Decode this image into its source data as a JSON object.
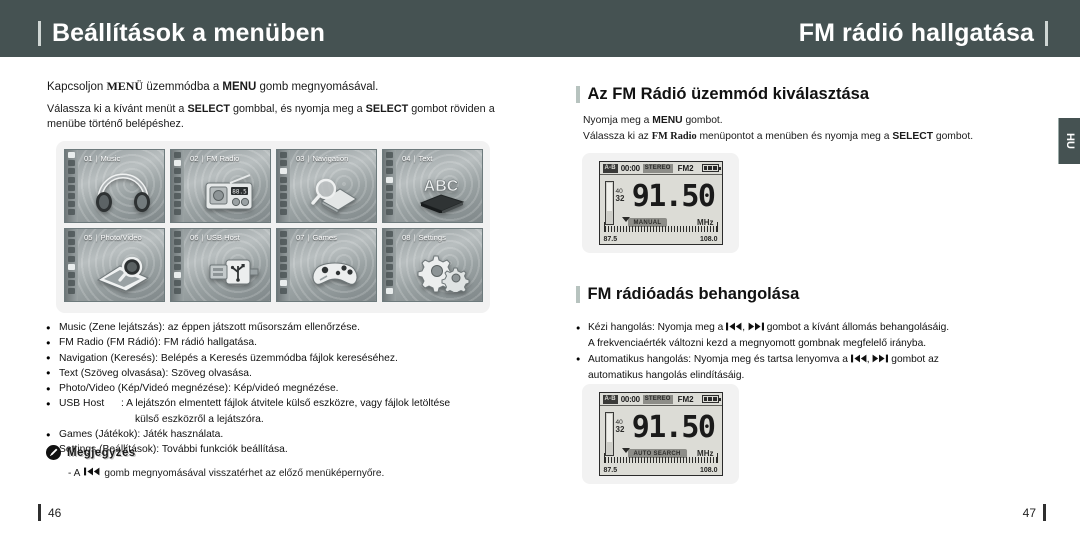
{
  "header": {
    "left_title": "Beállítások a menüben",
    "right_title": "FM rádió hallgatása",
    "side_tab": "HU"
  },
  "left": {
    "intro_line1_a": "Kapcsoljon ",
    "intro_line1_smallcaps": "MENÜ",
    "intro_line1_b": " üzemmódba a ",
    "intro_line1_bold": "MENU",
    "intro_line1_c": " gomb megnyomásával.",
    "intro_line2_a": "Válassza ki a kívánt menüt a ",
    "intro_line2_bold1": "SELECT",
    "intro_line2_b": " gombbal, és nyomja meg a ",
    "intro_line2_bold2": "SELECT",
    "intro_line2_c": " gombot röviden a menübe történő belépéshez.",
    "tiles": [
      {
        "num": "01",
        "label": "Music",
        "icon": "headphones-icon"
      },
      {
        "num": "02",
        "label": "FM Radio",
        "icon": "radio-icon"
      },
      {
        "num": "03",
        "label": "Navigation",
        "icon": "magnifier-book-icon"
      },
      {
        "num": "04",
        "label": "Text",
        "icon": "abc-book-icon"
      },
      {
        "num": "05",
        "label": "Photo/Video",
        "icon": "photo-magnifier-icon"
      },
      {
        "num": "06",
        "label": "USB Host",
        "icon": "usb-plug-icon"
      },
      {
        "num": "07",
        "label": "Games",
        "icon": "gamepad-icon"
      },
      {
        "num": "08",
        "label": "Settings",
        "icon": "gears-icon"
      }
    ],
    "bullets": [
      "Music (Zene lejátszás): az éppen játszott műsorszám ellenőrzése.",
      "FM Radio (FM Rádió): FM rádió hallgatása.",
      "Navigation (Keresés): Belépés a Keresés üzemmódba fájlok kereséséhez.",
      "Text (Szöveg olvasása): Szöveg olvasása.",
      "Photo/Video (Kép/Videó megnézése): Kép/videó megnézése."
    ],
    "usb_bullet": {
      "key": "USB Host",
      "line1": ": A lejátszón elmentett fájlok átvitele külső eszközre, vagy fájlok letöltése",
      "line2": "külső eszközről a lejátszóra."
    },
    "bullets_tail": [
      "Games (Játékok): Játék használata.",
      "Settings (Beállítások): További funkciók beállítása."
    ],
    "note_title": "Megjegyzés",
    "note_prefix": "-  A",
    "note_suffix": "gomb megnyomásával visszatérhet az előző menüképernyőre.",
    "page_number": "46"
  },
  "right": {
    "section1_title": "Az FM Rádió üzemmód kiválasztása",
    "section1_line1_a": "Nyomja meg a ",
    "section1_line1_bold": "MENU",
    "section1_line1_b": " gombot.",
    "section1_line2_a": "Válassza ki az ",
    "section1_line2_serif": "FM Radio",
    "section1_line2_b": " menüpontot a menüben és nyomja meg a ",
    "section1_line2_bold": "SELECT",
    "section1_line2_c": " gombot.",
    "section2_title": "FM rádióadás behangolása",
    "bullet1_a": "Kézi hangolás: Nyomja meg a",
    "bullet1_b": "gombot a kívánt állomás behangolásáig.",
    "bullet1_cont": "A frekvenciaérték változni kezd a megnyomott gombnak megfelelő irányba.",
    "bullet2_a": "Automatikus hangolás: Nyomja meg és tartsa lenyomva a",
    "bullet2_b": "gombot az",
    "bullet2_cont": "automatikus hangolás elindításáig.",
    "page_number": "47"
  },
  "lcd": {
    "time": "00:00",
    "stereo": "STEREO",
    "band": "FM2",
    "volume_label": "40",
    "volume_value": "32",
    "frequency": "91.50",
    "unit": "MHz",
    "mode_manual": "MANUAL",
    "mode_auto": "AUTO SEARCH",
    "scale_low": "87.5",
    "scale_high": "108.0"
  },
  "colors": {
    "header_band": "#455252",
    "accent_bar": "#b7c3bf",
    "panel_bg": "#f2f2f2",
    "lcd_bg": "#dcdcd6"
  }
}
